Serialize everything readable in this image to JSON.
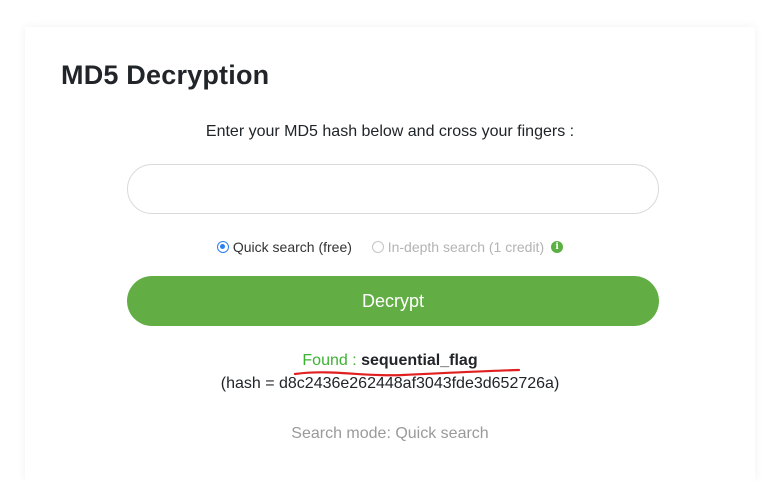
{
  "card": {
    "title": "MD5 Decryption",
    "prompt": "Enter your MD5 hash below and cross your fingers :",
    "hash_input": {
      "value": "",
      "placeholder": ""
    },
    "options": {
      "quick": {
        "label": "Quick search (free)",
        "selected": true
      },
      "indepth": {
        "label": "In-depth search (1 credit)",
        "selected": false
      }
    },
    "decrypt_label": "Decrypt",
    "result": {
      "found_label": "Found :",
      "found_value": "sequential_flag",
      "hash_line": "(hash = d8c2436e262448af3043fde3d652726a)"
    },
    "search_mode": "Search mode: Quick search"
  },
  "colors": {
    "accent_green": "#63ad45",
    "found_green": "#3cb233",
    "annotation_red": "#e02020",
    "radio_blue": "#2f80ed"
  }
}
